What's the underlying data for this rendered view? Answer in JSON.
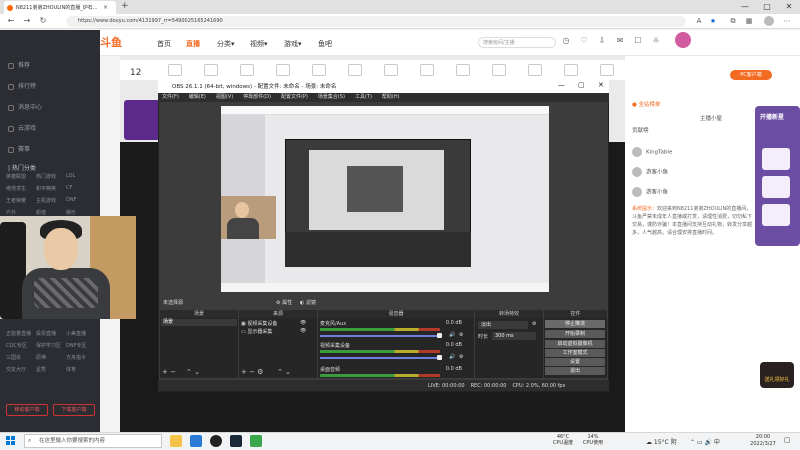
{
  "browser": {
    "tab_title": "N8211弟弟ZHOULIN的直播_炉石...",
    "tab_close": "×",
    "new_tab": "+",
    "url": "https://www.douyu.com/4131997_rr=5490025165241690",
    "window_controls": [
      "—",
      "▢",
      "✕"
    ]
  },
  "site": {
    "logo": "斗鱼",
    "nav": [
      "首页",
      "直播",
      "分类▾",
      "视频▾",
      "游戏▾",
      "鱼吧"
    ],
    "search_placeholder": "搜索房间/主播",
    "live_count": "12",
    "pc_button": "PC客户端"
  },
  "sidebar": {
    "items": [
      "推荐",
      "排行榜",
      "消息中心",
      "云游戏",
      "赛事"
    ],
    "section_title": "| 热门分类",
    "categories_a": [
      "英雄联盟",
      "热门游戏",
      "LOL",
      "绝地求生",
      "和平精英",
      "CF",
      "王者荣耀",
      "主机游戏",
      "DNF",
      "户外",
      "颜值",
      "娱乐",
      "穿越火线",
      "二次元",
      "炉石"
    ],
    "categories_b": [
      "正能量直播",
      "投票直播",
      "小美直播",
      "COC专区",
      "保护学习区",
      "DNF专区",
      "三国杀",
      "原神",
      "方舟指令",
      "交友大厅",
      "星秀",
      "体育"
    ],
    "btn_left": "移动客户端",
    "btn_right": "下载客户端"
  },
  "obs": {
    "title": "OBS 26.1.1 (64-bit, windows) - 配置文件: 未命名 - 场景: 未命名",
    "window_controls": [
      "—",
      "▢",
      "✕"
    ],
    "menu": [
      "文件(F)",
      "编辑(E)",
      "视图(V)",
      "停靠部件(D)",
      "配置文件(P)",
      "场景集合(S)",
      "工具(T)",
      "帮助(H)"
    ],
    "status_source_label": "未选择源",
    "toggle_properties": "属性",
    "toggle_filters": "滤镜",
    "docks": {
      "scenes": "场景",
      "sources": "来源",
      "mixer": "混音器",
      "transitions": "转场特效",
      "controls": "控件"
    },
    "scene_item": "场景",
    "sources": [
      "视频采集设备",
      "显示器采集"
    ],
    "mixer": [
      {
        "name": "麦克风/Aux",
        "db": "0.0 dB"
      },
      {
        "name": "视频采集设备",
        "db": "0.0 dB"
      },
      {
        "name": "桌面音频",
        "db": "0.0 dB"
      }
    ],
    "transition_value": "淡出",
    "duration_label": "时长",
    "duration_value": "300 ms",
    "controls": [
      "停止推流",
      "开始录制",
      "启动虚拟摄像机",
      "工作室模式",
      "设置",
      "退出"
    ],
    "statusbar": [
      "LIVE: 00:00:00",
      "REC: 00:00:00",
      "CPU: 2.0%, 60.00 fps"
    ]
  },
  "right_panel": {
    "rows": [
      "● 全站榜单",
      "主播小屋",
      "贡献榜"
    ],
    "viewers": [
      "KingTable",
      "游客小鱼",
      "游客小鱼"
    ],
    "chat_name": "系统提示：",
    "chat_text": "欢迎来到N8211弟弟ZHOULIN的直播间，斗鱼严禁未成年人直播或打赏，请理性消费，切勿私下交易，谨防诈骗！本直播间支持互动礼物，转发分享越多，人气越高，请合理安排直播时间。",
    "floater_title": "开播新星",
    "badge": "送礼领好礼"
  },
  "taskbar": {
    "search": "在这里输入你要搜索的内容",
    "cpu_temp": "46°C\nCPU温度",
    "cpu_usage": "14%\nCPU使用",
    "weather": "15°C 阴",
    "time": "20:00",
    "date": "2022/3/27"
  }
}
